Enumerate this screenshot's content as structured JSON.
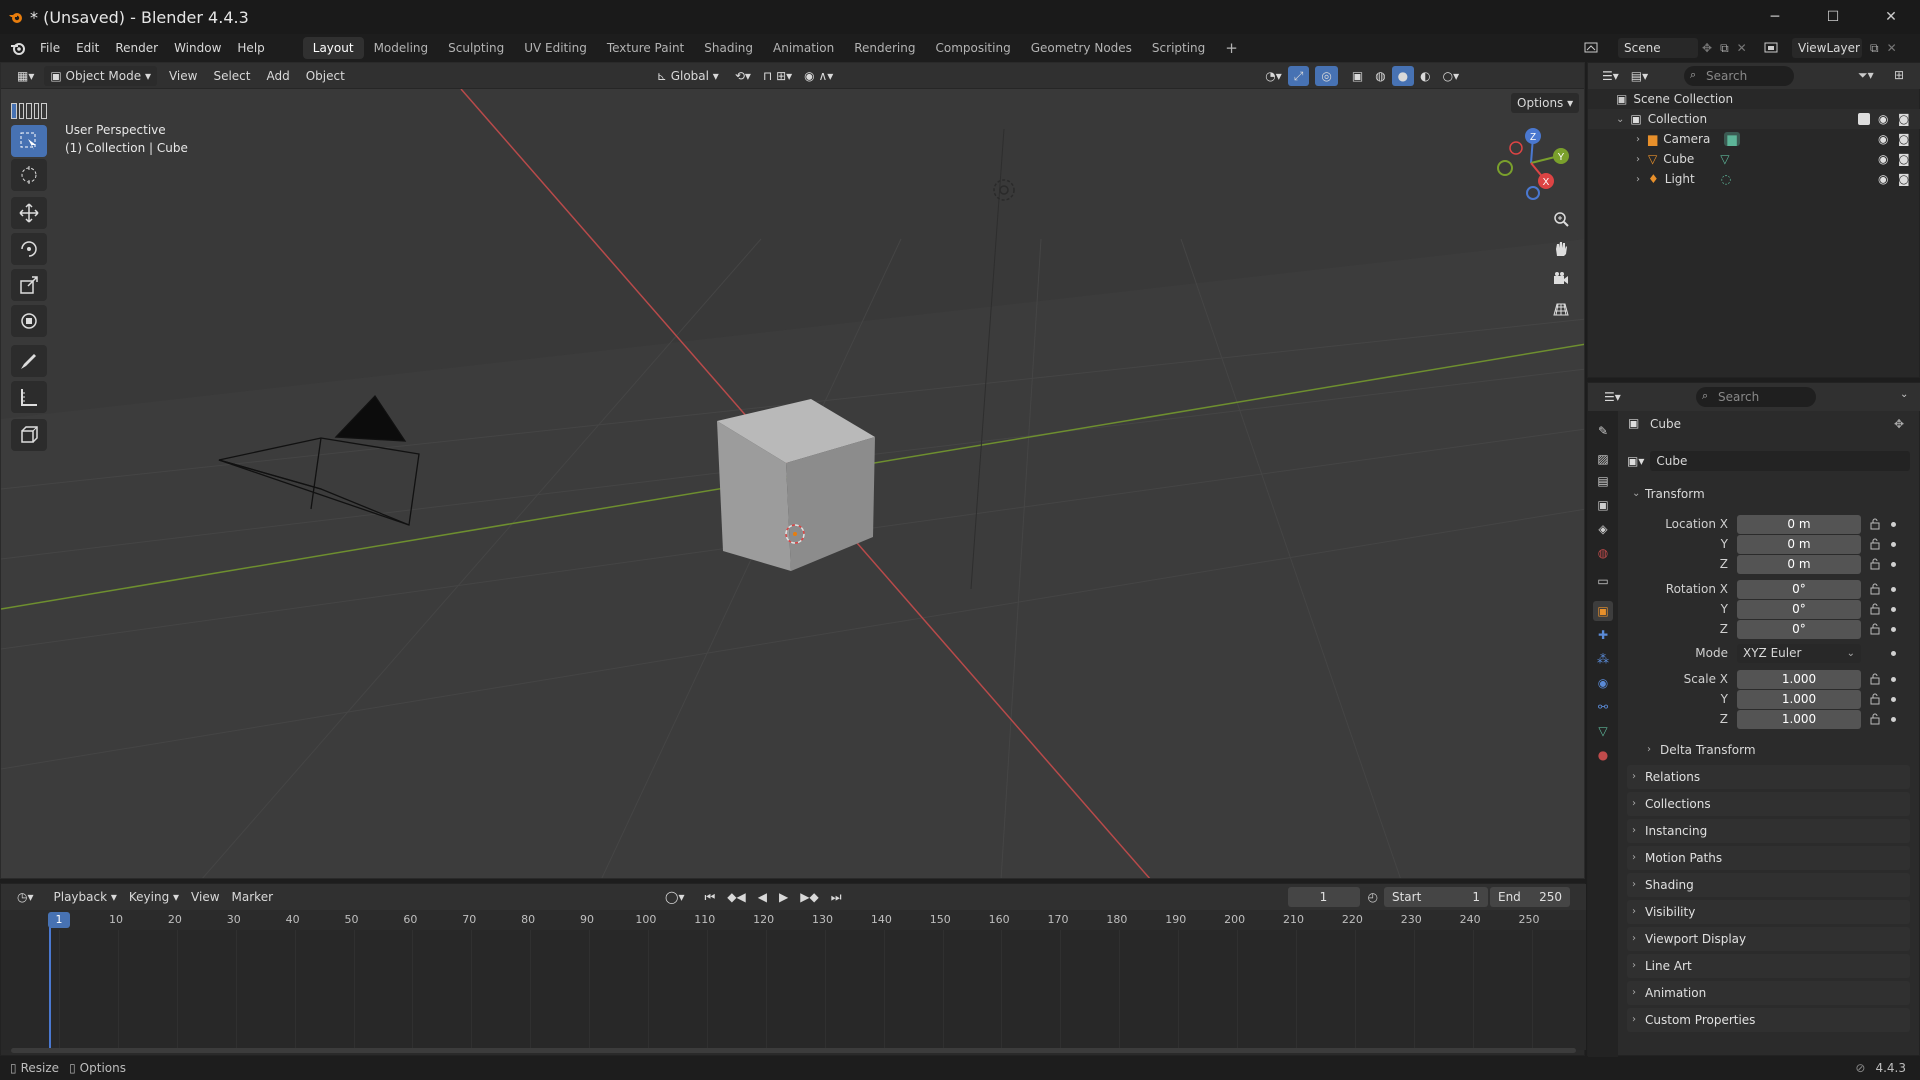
{
  "window": {
    "title": "* (Unsaved) - Blender 4.4.3",
    "minimize": "─",
    "maximize": "☐",
    "close": "✕"
  },
  "menu": [
    "File",
    "Edit",
    "Render",
    "Window",
    "Help"
  ],
  "workspaces": [
    "Layout",
    "Modeling",
    "Sculpting",
    "UV Editing",
    "Texture Paint",
    "Shading",
    "Animation",
    "Rendering",
    "Compositing",
    "Geometry Nodes",
    "Scripting"
  ],
  "active_workspace": "Layout",
  "scene": {
    "name": "Scene",
    "view_layer": "ViewLayer"
  },
  "viewport": {
    "mode": "Object Mode",
    "menus": [
      "View",
      "Select",
      "Add",
      "Object"
    ],
    "orientation": "Global",
    "options": "Options",
    "overlay_line1": "User Perspective",
    "overlay_line2": "(1) Collection | Cube",
    "gizmo": {
      "x": "X",
      "y": "Y",
      "z": "Z"
    }
  },
  "timeline": {
    "menus": [
      "Playback",
      "Keying",
      "View",
      "Marker"
    ],
    "current_frame": "1",
    "start_label": "Start",
    "start": "1",
    "end_label": "End",
    "end": "250",
    "ruler": [
      "1",
      "10",
      "20",
      "30",
      "40",
      "50",
      "60",
      "70",
      "80",
      "90",
      "100",
      "110",
      "120",
      "130",
      "140",
      "150",
      "160",
      "170",
      "180",
      "190",
      "200",
      "210",
      "220",
      "230",
      "240",
      "250"
    ]
  },
  "status": {
    "left1": "Resize",
    "left2": "Options",
    "version": "4.4.3"
  },
  "outliner": {
    "search_placeholder": "Search",
    "root": "Scene Collection",
    "collection": "Collection",
    "items": [
      "Camera",
      "Cube",
      "Light"
    ]
  },
  "properties": {
    "search_placeholder": "Search",
    "object_name": "Cube",
    "datablock": "Cube",
    "transform_title": "Transform",
    "location_label": "Location X",
    "rotation_label": "Rotation X",
    "scale_label": "Scale X",
    "y_label": "Y",
    "z_label": "Z",
    "location": [
      "0 m",
      "0 m",
      "0 m"
    ],
    "rotation": [
      "0°",
      "0°",
      "0°"
    ],
    "mode_label": "Mode",
    "mode": "XYZ Euler",
    "scale": [
      "1.000",
      "1.000",
      "1.000"
    ],
    "delta": "Delta Transform",
    "panels": [
      "Relations",
      "Collections",
      "Instancing",
      "Motion Paths",
      "Shading",
      "Visibility",
      "Viewport Display",
      "Line Art",
      "Animation",
      "Custom Properties"
    ]
  }
}
